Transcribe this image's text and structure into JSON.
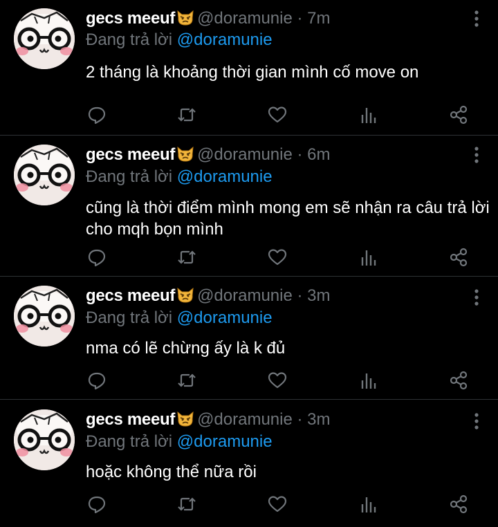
{
  "colors": {
    "background": "#000000",
    "text": "#ffffff",
    "secondary": "#71767b",
    "link": "#1d9bf0",
    "divider": "#2f3336"
  },
  "icons": {
    "emoji": "pouting-cat-emoji",
    "more": "more-vertical-icon",
    "reply": "reply-icon",
    "retweet": "retweet-icon",
    "like": "heart-icon",
    "views": "views-chart-icon",
    "share": "share-icon"
  },
  "tweets": [
    {
      "display_name": "gecs meeuf",
      "handle": "@doramunie",
      "separator": "·",
      "time": "7m",
      "reply_prefix": "Đang trả lời",
      "reply_to": "@doramunie",
      "text": "2 tháng là khoảng thời gian mình cố move on"
    },
    {
      "display_name": "gecs meeuf",
      "handle": "@doramunie",
      "separator": "·",
      "time": "6m",
      "reply_prefix": "Đang trả lời",
      "reply_to": "@doramunie",
      "text": "cũng là thời điểm mình mong em sẽ nhận ra câu trả lời cho mqh bọn mình"
    },
    {
      "display_name": "gecs meeuf",
      "handle": "@doramunie",
      "separator": "·",
      "time": "3m",
      "reply_prefix": "Đang trả lời",
      "reply_to": "@doramunie",
      "text": "nma có lẽ chừng ấy là k đủ"
    },
    {
      "display_name": "gecs meeuf",
      "handle": "@doramunie",
      "separator": "·",
      "time": "3m",
      "reply_prefix": "Đang trả lời",
      "reply_to": "@doramunie",
      "text": "hoặc không thể nữa rồi"
    }
  ]
}
